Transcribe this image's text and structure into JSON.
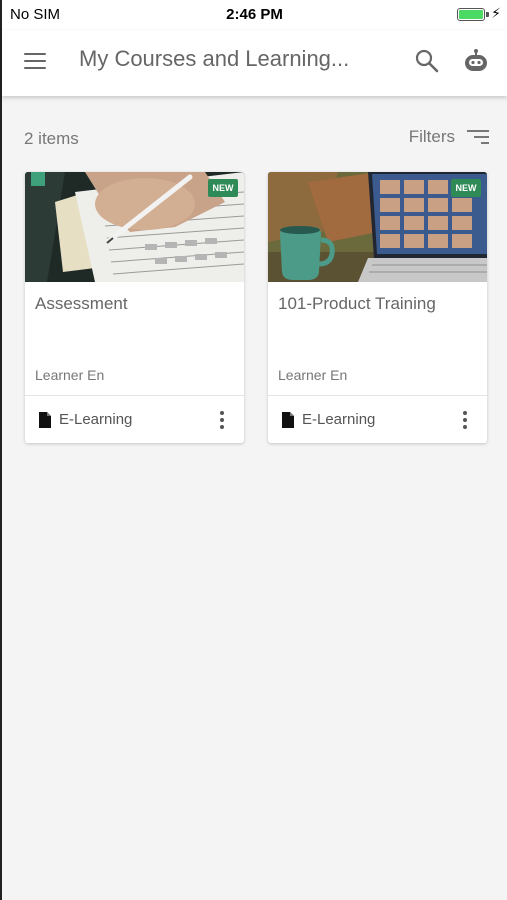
{
  "status_bar": {
    "carrier": "No SIM",
    "time": "2:46 PM",
    "battery_level": 1.0
  },
  "header": {
    "title": "My Courses and Learning..."
  },
  "list": {
    "count_label": "2 items",
    "filters_label": "Filters"
  },
  "courses": [
    {
      "badge": "NEW",
      "title": "Assessment",
      "author": "Learner En",
      "type": "E-Learning"
    },
    {
      "badge": "NEW",
      "title": "101-Product Training",
      "author": "Learner En",
      "type": "E-Learning"
    }
  ],
  "colors": {
    "badge": "#2e8b57",
    "header_bg": "#ffffff",
    "page_bg": "#f4f4f4",
    "battery": "#4cd964"
  },
  "icons": [
    "menu-icon",
    "search-icon",
    "bot-icon",
    "filter-icon",
    "document-icon",
    "more-vertical-icon",
    "charging-icon"
  ]
}
